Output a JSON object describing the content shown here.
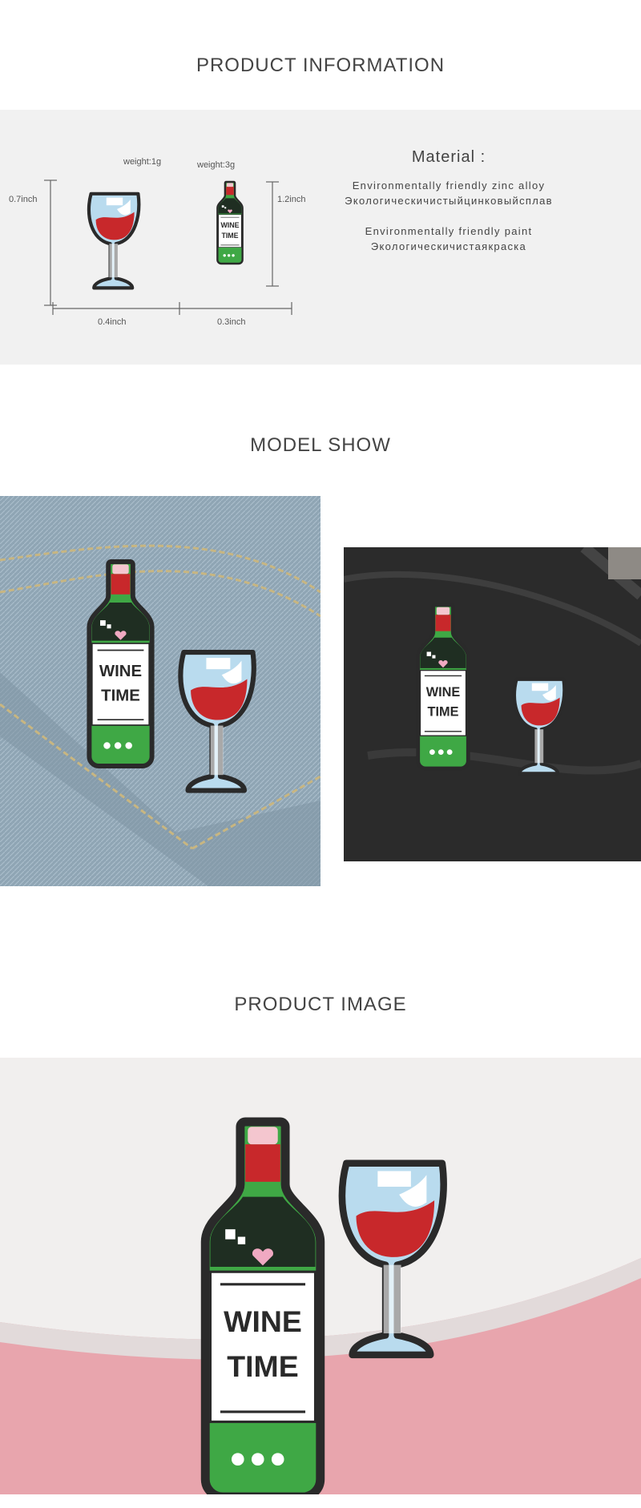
{
  "sections": {
    "info_title": "PRODUCT INFORMATION",
    "model_title": "MODEL SHOW",
    "image_title": "PRODUCT IMAGE"
  },
  "dimensions": {
    "weight_glass": "weight:1g",
    "weight_bottle": "weight:3g",
    "height_glass": "0.7inch",
    "height_bottle": "1.2inch",
    "width_glass": "0.4inch",
    "width_bottle": "0.3inch"
  },
  "pin_text": {
    "line1": "WINE",
    "line2": "TIME"
  },
  "material": {
    "title": "Material :",
    "lines": [
      "Environmentally friendly zinc alloy",
      "Экологическичистыйцинковыйсплав",
      "Environmentally friendly paint",
      "Экологическичистаякраска"
    ]
  },
  "colors": {
    "bottle_green": "#3fa845",
    "wine_red": "#c8282b",
    "glass_blue": "#b9dbee",
    "outline": "#2a2a2a",
    "panel_bg": "#f1f1f1"
  }
}
